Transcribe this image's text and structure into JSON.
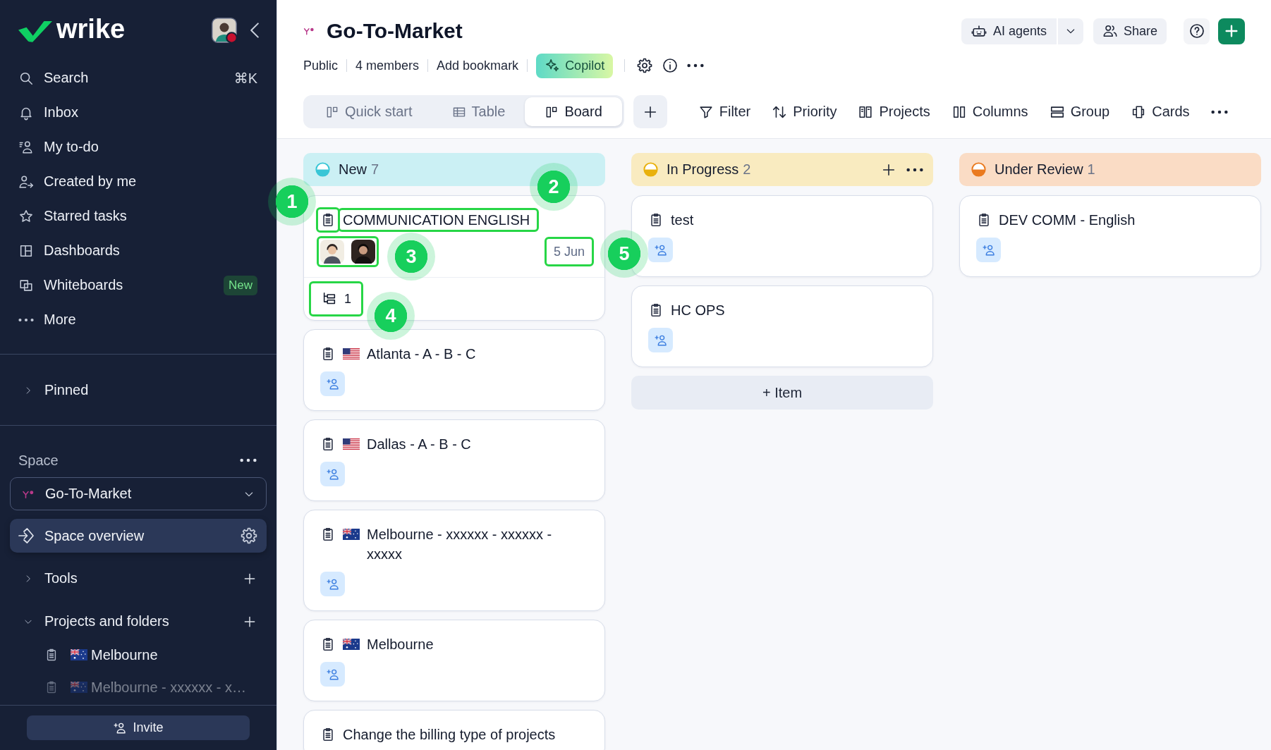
{
  "sidebar": {
    "logo": "wrike",
    "nav": [
      {
        "label": "Search",
        "shortcut": "⌘K",
        "selected": false
      },
      {
        "label": "Inbox",
        "selected": false
      },
      {
        "label": "My to-do",
        "selected": false
      },
      {
        "label": "Created by me",
        "selected": false
      },
      {
        "label": "Starred tasks",
        "selected": false
      },
      {
        "label": "Dashboards",
        "selected": false
      },
      {
        "label": "Whiteboards",
        "badge": "New",
        "selected": false
      },
      {
        "label": "More",
        "selected": false
      }
    ],
    "pinned": {
      "label": "Pinned",
      "expanded": false
    },
    "space": {
      "label": "Space",
      "selector": "Go-To-Market",
      "overview": {
        "label": "Space overview",
        "selected": true
      },
      "sections": [
        {
          "label": "Tools",
          "expanded": false
        },
        {
          "label": "Projects and folders",
          "expanded": true,
          "children": [
            {
              "label": "Melbourne",
              "kind": "au",
              "selected": false
            },
            {
              "label": "Melbourne - xxxxxx - x…",
              "kind": "au",
              "selected": false
            }
          ]
        }
      ]
    },
    "invite": "Invite"
  },
  "header": {
    "title": "Go-To-Market",
    "meta": [
      "Public",
      "4 members",
      "Add bookmark"
    ],
    "copilot": "Copilot",
    "ai_agents": "AI agents",
    "share": "Share"
  },
  "view_tabs": [
    {
      "label": "Quick start",
      "selected": false
    },
    {
      "label": "Table",
      "selected": false
    },
    {
      "label": "Board",
      "selected": true
    }
  ],
  "toolbar": [
    "Filter",
    "Priority",
    "Projects",
    "Columns",
    "Group",
    "Cards"
  ],
  "board": {
    "columns": [
      {
        "name": "New",
        "count": "7",
        "color": "#38c6d6",
        "hovered": false,
        "cards": [
          {
            "title": "COMMUNICATION ENGLISH",
            "kind": "plain",
            "highlighted": true,
            "assignees": [
              {
                "kind": "cartoon"
              },
              {
                "kind": "photo"
              }
            ],
            "due": "5 Jun",
            "subtasks": "1"
          },
          {
            "title": "Atlanta - A - B - C",
            "kind": "us",
            "highlighted": false,
            "add_assignee": true
          },
          {
            "title": "Dallas - A - B - C",
            "kind": "us",
            "highlighted": false,
            "add_assignee": true
          },
          {
            "title": "Melbourne - xxxxxx - xxxxxx - xxxxx",
            "kind": "au",
            "highlighted": false,
            "add_assignee": true
          },
          {
            "title": "Melbourne",
            "kind": "au",
            "highlighted": false,
            "add_assignee": true
          },
          {
            "title": "Change the billing type of projects",
            "kind": "plain",
            "highlighted": false
          }
        ]
      },
      {
        "name": "In Progress",
        "count": "2",
        "color": "#e9b10c",
        "hovered": true,
        "cards": [
          {
            "title": "test",
            "kind": "plain",
            "highlighted": false,
            "add_assignee": true
          },
          {
            "title": "HC OPS",
            "kind": "plain",
            "highlighted": false,
            "add_assignee": true
          }
        ],
        "add_item": "+ Item"
      },
      {
        "name": "Under Review",
        "count": "1",
        "color": "#ea7a1f",
        "hovered": false,
        "cards": [
          {
            "title": "DEV COMM - English",
            "kind": "plain",
            "highlighted": false,
            "add_assignee": true
          }
        ]
      }
    ],
    "callouts": [
      "1",
      "2",
      "3",
      "4",
      "5"
    ]
  }
}
